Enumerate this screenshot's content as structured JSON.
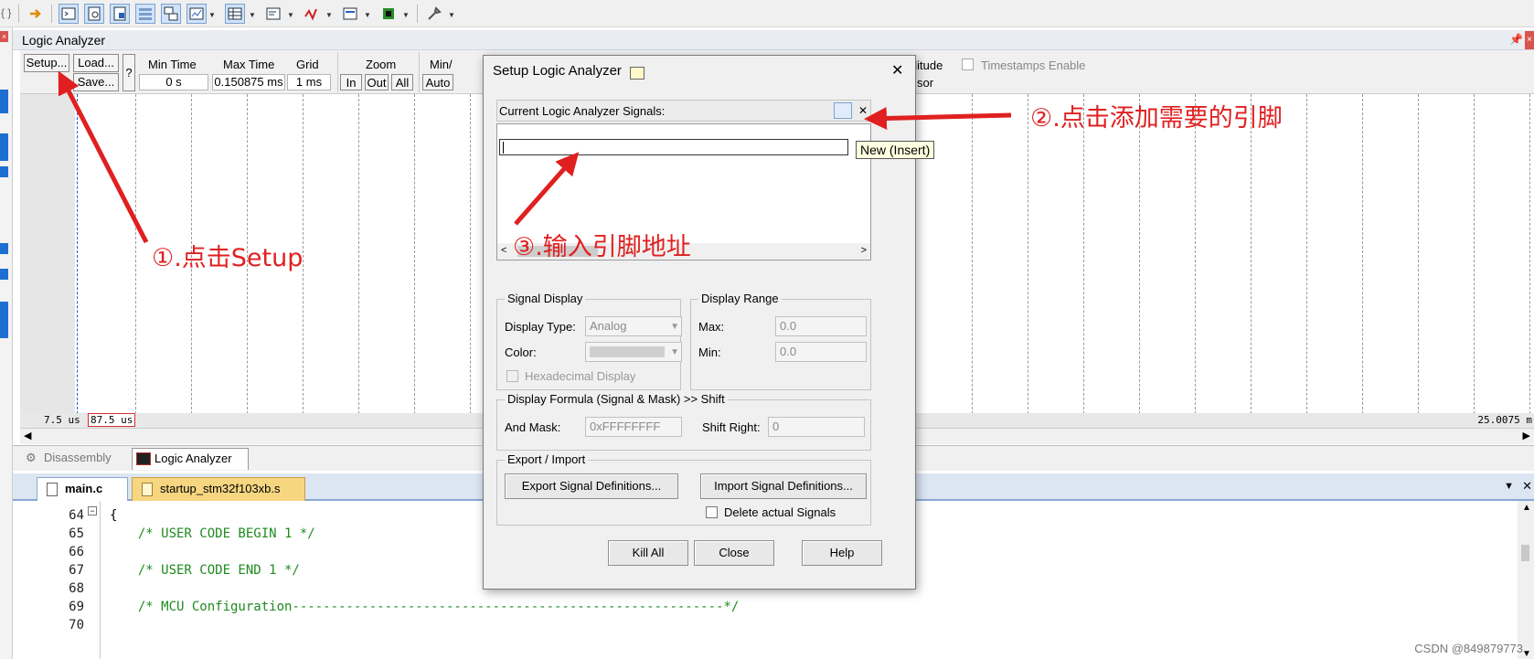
{
  "toolbar": {
    "braces": "{ }",
    "icons": [
      "arrow-right-icon",
      "command-window-icon",
      "disassembly-window-icon",
      "symbols-window-icon",
      "registers-window-icon",
      "call-stack-icon",
      "watch-window-icon",
      "memory-window-icon",
      "serial-window-icon",
      "analysis-window-icon",
      "trace-window-icon",
      "system-viewer-icon",
      "toolbox-icon"
    ]
  },
  "logic_analyzer": {
    "title": "Logic Analyzer",
    "setup": "Setup...",
    "load": "Load...",
    "save": "Save...",
    "help_q": "?",
    "min_time_label": "Min Time",
    "min_time_value": "0 s",
    "max_time_label": "Max Time",
    "max_time_value": "0.150875 ms",
    "grid_label": "Grid",
    "grid_value": "1 ms",
    "zoom_label": "Zoom",
    "zoom_in": "In",
    "zoom_out": "Out",
    "zoom_all": "All",
    "minmax_label": "Min/",
    "auto": "Auto",
    "amplitude_fragment": "plitude",
    "cursor_fragment": "sor",
    "timestamps": "Timestamps Enable",
    "time_left": "7.5 us",
    "time_cursor": "87.5 us",
    "time_right": "25.0075 m"
  },
  "bottom_tabs": [
    "Disassembly",
    "Logic Analyzer"
  ],
  "editor_tabs": [
    "main.c",
    "startup_stm32f103xb.s"
  ],
  "code": {
    "lines": [
      {
        "n": "64",
        "t": "{"
      },
      {
        "n": "65",
        "t": "  /* USER CODE BEGIN 1 */"
      },
      {
        "n": "66",
        "t": ""
      },
      {
        "n": "67",
        "t": "  /* USER CODE END 1 */"
      },
      {
        "n": "68",
        "t": ""
      },
      {
        "n": "69",
        "t": "  /* MCU Configuration--------------------------------------------------------*/"
      },
      {
        "n": "70",
        "t": ""
      }
    ]
  },
  "dialog": {
    "title": "Setup Logic Analyzer",
    "close": "✕",
    "signals_label": "Current Logic Analyzer Signals:",
    "tooltip": "New (Insert)",
    "signal_display": "Signal Display",
    "display_type_label": "Display Type:",
    "display_type_value": "Analog",
    "color_label": "Color:",
    "hex_display": "Hexadecimal Display",
    "display_range": "Display Range",
    "max_label": "Max:",
    "max_value": "0.0",
    "min_label": "Min:",
    "min_value": "0.0",
    "formula_title": "Display Formula (Signal & Mask) >> Shift",
    "and_mask_label": "And Mask:",
    "and_mask_value": "0xFFFFFFFF",
    "shift_label": "Shift Right:",
    "shift_value": "0",
    "export_import": "Export / Import",
    "export_btn": "Export Signal Definitions...",
    "import_btn": "Import Signal Definitions...",
    "delete_signals": "Delete actual Signals",
    "kill_all": "Kill All",
    "close_btn": "Close",
    "help": "Help"
  },
  "annotations": {
    "step1": "①.点击Setup",
    "step2": "②.点击添加需要的引脚",
    "step3": "③.输入引脚地址",
    "color": "#e02020"
  },
  "watermark": "CSDN @849879773"
}
